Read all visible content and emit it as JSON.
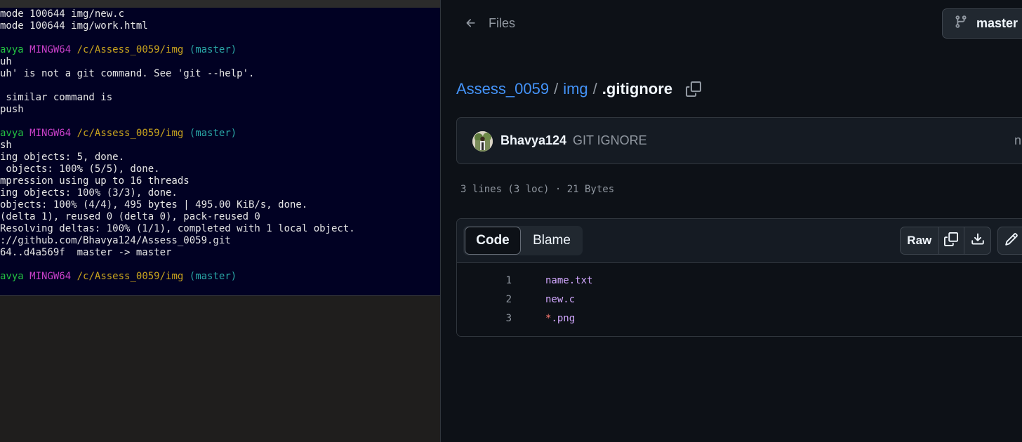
{
  "terminal": {
    "prompt": {
      "user": "avya",
      "host": "MINGW64",
      "path": "/c/Assess_0059/img",
      "branch": "(master)"
    },
    "lines": [
      {
        "kind": "text",
        "text": "mode 100644 img/new.c"
      },
      {
        "kind": "text",
        "text": "mode 100644 img/work.html"
      },
      {
        "kind": "blank",
        "text": ""
      },
      {
        "kind": "prompt",
        "text": ""
      },
      {
        "kind": "text",
        "text": "uh"
      },
      {
        "kind": "text",
        "text": "uh' is not a git command. See 'git --help'."
      },
      {
        "kind": "blank",
        "text": ""
      },
      {
        "kind": "text",
        "text": " similar command is"
      },
      {
        "kind": "text",
        "text": "push"
      },
      {
        "kind": "blank",
        "text": ""
      },
      {
        "kind": "prompt",
        "text": ""
      },
      {
        "kind": "text",
        "text": "sh"
      },
      {
        "kind": "text",
        "text": "ing objects: 5, done."
      },
      {
        "kind": "text",
        "text": " objects: 100% (5/5), done."
      },
      {
        "kind": "text",
        "text": "mpression using up to 16 threads"
      },
      {
        "kind": "text",
        "text": "ing objects: 100% (3/3), done."
      },
      {
        "kind": "text",
        "text": "objects: 100% (4/4), 495 bytes | 495.00 KiB/s, done."
      },
      {
        "kind": "text",
        "text": "(delta 1), reused 0 (delta 0), pack-reused 0"
      },
      {
        "kind": "text",
        "text": "Resolving deltas: 100% (1/1), completed with 1 local object."
      },
      {
        "kind": "text",
        "text": "://github.com/Bhavya124/Assess_0059.git"
      },
      {
        "kind": "text",
        "text": "64..d4a569f  master -> master"
      },
      {
        "kind": "blank",
        "text": ""
      },
      {
        "kind": "prompt",
        "text": ""
      }
    ]
  },
  "github": {
    "files_link": {
      "label": "Files",
      "icon": "arrow-left-icon"
    },
    "branch": {
      "label": "master",
      "icon": "git-branch-icon"
    },
    "breadcrumb": {
      "repo": "Assess_0059",
      "folder": "img",
      "file": ".gitignore",
      "separator": "/"
    },
    "commit": {
      "author": "Bhavya124",
      "message": "GIT IGNORE",
      "meta_truncated": "n"
    },
    "file_stats": "3 lines (3 loc) · 21 Bytes",
    "view_tabs": {
      "code": "Code",
      "blame": "Blame"
    },
    "actions": {
      "raw": "Raw",
      "copy_icon": "copy-icon",
      "download_icon": "download-icon",
      "edit_icon": "pencil-icon"
    },
    "code_lines": [
      {
        "num": "1",
        "text": "name.txt"
      },
      {
        "num": "2",
        "text": "new.c"
      },
      {
        "num": "3",
        "star": "*",
        "rest": ".png"
      }
    ],
    "colors": {
      "background": "#0d1117",
      "link": "#4493f8",
      "syntax": "#d2a8ff",
      "glob": "#ff7b72"
    }
  }
}
